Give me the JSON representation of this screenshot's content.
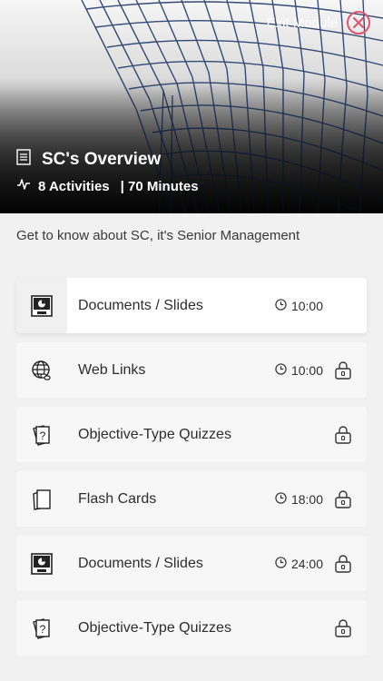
{
  "header": {
    "exit_label": "Exit Module",
    "title": "SC's Overview",
    "activities": "8 Activities",
    "duration": "| 70 Minutes"
  },
  "description": "Get to know about SC, it's Senior Management",
  "activities": [
    {
      "label": "Documents / Slides",
      "icon": "ppt-document-icon",
      "time": "10:00",
      "locked": false
    },
    {
      "label": "Web Links",
      "icon": "globe-link-icon",
      "time": "10:00",
      "locked": true
    },
    {
      "label": "Objective-Type Quizzes",
      "icon": "quiz-question-icon",
      "time": "",
      "locked": true
    },
    {
      "label": "Flash Cards",
      "icon": "flash-cards-icon",
      "time": "18:00",
      "locked": true
    },
    {
      "label": "Documents / Slides",
      "icon": "ppt-document-icon",
      "time": "24:00",
      "locked": true
    },
    {
      "label": "Objective-Type Quizzes",
      "icon": "quiz-question-icon",
      "time": "",
      "locked": true
    }
  ],
  "colors": {
    "accent": "#e05270",
    "background": "#f1f1f1",
    "card": "#f7f7f7"
  }
}
